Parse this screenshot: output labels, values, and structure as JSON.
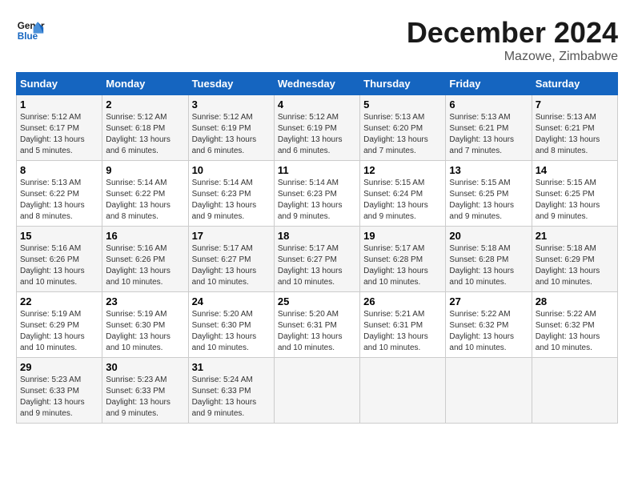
{
  "header": {
    "logo_line1": "General",
    "logo_line2": "Blue",
    "month_title": "December 2024",
    "location": "Mazowe, Zimbabwe"
  },
  "days_of_week": [
    "Sunday",
    "Monday",
    "Tuesday",
    "Wednesday",
    "Thursday",
    "Friday",
    "Saturday"
  ],
  "weeks": [
    [
      {
        "day": "1",
        "sunrise": "5:12 AM",
        "sunset": "6:17 PM",
        "daylight": "13 hours and 5 minutes."
      },
      {
        "day": "2",
        "sunrise": "5:12 AM",
        "sunset": "6:18 PM",
        "daylight": "13 hours and 6 minutes."
      },
      {
        "day": "3",
        "sunrise": "5:12 AM",
        "sunset": "6:19 PM",
        "daylight": "13 hours and 6 minutes."
      },
      {
        "day": "4",
        "sunrise": "5:12 AM",
        "sunset": "6:19 PM",
        "daylight": "13 hours and 6 minutes."
      },
      {
        "day": "5",
        "sunrise": "5:13 AM",
        "sunset": "6:20 PM",
        "daylight": "13 hours and 7 minutes."
      },
      {
        "day": "6",
        "sunrise": "5:13 AM",
        "sunset": "6:21 PM",
        "daylight": "13 hours and 7 minutes."
      },
      {
        "day": "7",
        "sunrise": "5:13 AM",
        "sunset": "6:21 PM",
        "daylight": "13 hours and 8 minutes."
      }
    ],
    [
      {
        "day": "8",
        "sunrise": "5:13 AM",
        "sunset": "6:22 PM",
        "daylight": "13 hours and 8 minutes."
      },
      {
        "day": "9",
        "sunrise": "5:14 AM",
        "sunset": "6:22 PM",
        "daylight": "13 hours and 8 minutes."
      },
      {
        "day": "10",
        "sunrise": "5:14 AM",
        "sunset": "6:23 PM",
        "daylight": "13 hours and 9 minutes."
      },
      {
        "day": "11",
        "sunrise": "5:14 AM",
        "sunset": "6:23 PM",
        "daylight": "13 hours and 9 minutes."
      },
      {
        "day": "12",
        "sunrise": "5:15 AM",
        "sunset": "6:24 PM",
        "daylight": "13 hours and 9 minutes."
      },
      {
        "day": "13",
        "sunrise": "5:15 AM",
        "sunset": "6:25 PM",
        "daylight": "13 hours and 9 minutes."
      },
      {
        "day": "14",
        "sunrise": "5:15 AM",
        "sunset": "6:25 PM",
        "daylight": "13 hours and 9 minutes."
      }
    ],
    [
      {
        "day": "15",
        "sunrise": "5:16 AM",
        "sunset": "6:26 PM",
        "daylight": "13 hours and 10 minutes."
      },
      {
        "day": "16",
        "sunrise": "5:16 AM",
        "sunset": "6:26 PM",
        "daylight": "13 hours and 10 minutes."
      },
      {
        "day": "17",
        "sunrise": "5:17 AM",
        "sunset": "6:27 PM",
        "daylight": "13 hours and 10 minutes."
      },
      {
        "day": "18",
        "sunrise": "5:17 AM",
        "sunset": "6:27 PM",
        "daylight": "13 hours and 10 minutes."
      },
      {
        "day": "19",
        "sunrise": "5:17 AM",
        "sunset": "6:28 PM",
        "daylight": "13 hours and 10 minutes."
      },
      {
        "day": "20",
        "sunrise": "5:18 AM",
        "sunset": "6:28 PM",
        "daylight": "13 hours and 10 minutes."
      },
      {
        "day": "21",
        "sunrise": "5:18 AM",
        "sunset": "6:29 PM",
        "daylight": "13 hours and 10 minutes."
      }
    ],
    [
      {
        "day": "22",
        "sunrise": "5:19 AM",
        "sunset": "6:29 PM",
        "daylight": "13 hours and 10 minutes."
      },
      {
        "day": "23",
        "sunrise": "5:19 AM",
        "sunset": "6:30 PM",
        "daylight": "13 hours and 10 minutes."
      },
      {
        "day": "24",
        "sunrise": "5:20 AM",
        "sunset": "6:30 PM",
        "daylight": "13 hours and 10 minutes."
      },
      {
        "day": "25",
        "sunrise": "5:20 AM",
        "sunset": "6:31 PM",
        "daylight": "13 hours and 10 minutes."
      },
      {
        "day": "26",
        "sunrise": "5:21 AM",
        "sunset": "6:31 PM",
        "daylight": "13 hours and 10 minutes."
      },
      {
        "day": "27",
        "sunrise": "5:22 AM",
        "sunset": "6:32 PM",
        "daylight": "13 hours and 10 minutes."
      },
      {
        "day": "28",
        "sunrise": "5:22 AM",
        "sunset": "6:32 PM",
        "daylight": "13 hours and 10 minutes."
      }
    ],
    [
      {
        "day": "29",
        "sunrise": "5:23 AM",
        "sunset": "6:33 PM",
        "daylight": "13 hours and 9 minutes."
      },
      {
        "day": "30",
        "sunrise": "5:23 AM",
        "sunset": "6:33 PM",
        "daylight": "13 hours and 9 minutes."
      },
      {
        "day": "31",
        "sunrise": "5:24 AM",
        "sunset": "6:33 PM",
        "daylight": "13 hours and 9 minutes."
      },
      null,
      null,
      null,
      null
    ]
  ],
  "labels": {
    "sunrise": "Sunrise:",
    "sunset": "Sunset:",
    "daylight": "Daylight: 13 hours"
  }
}
